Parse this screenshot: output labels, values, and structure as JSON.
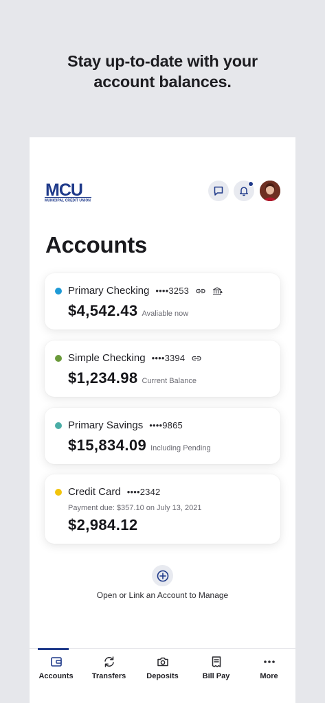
{
  "headline": {
    "line1": "Stay up-to-date with your",
    "line2": "account balances."
  },
  "header": {
    "logo_text": "MCU",
    "logo_subtext": "MUNICIPAL CREDIT UNION",
    "message_icon": "chat-bubble-icon",
    "bell_icon": "bell-icon",
    "avatar_icon": "user-avatar"
  },
  "page_title": "Accounts",
  "accounts": [
    {
      "name": "Primary Checking",
      "mask": "••••3253",
      "amount": "$4,542.43",
      "label": "Avaliable now",
      "color": "#1e9ad6"
    },
    {
      "name": "Simple Checking",
      "mask": "••••3394",
      "amount": "$1,234.98",
      "label": "Current Balance",
      "color": "#6a9a3a"
    },
    {
      "name": "Primary Savings",
      "mask": "••••9865",
      "amount": "$15,834.09",
      "label": "Including Pending",
      "color": "#4aada6"
    },
    {
      "name": "Credit Card",
      "mask": "••••2342",
      "payment_due": "Payment due: $357.10 on July 13, 2021",
      "amount": "$2,984.12",
      "color": "#f2c40c"
    }
  ],
  "add_account": {
    "label": "Open or Link an Account to Manage"
  },
  "tabs": [
    {
      "label": "Accounts",
      "icon": "wallet-icon"
    },
    {
      "label": "Transfers",
      "icon": "transfer-arrows-icon"
    },
    {
      "label": "Deposits",
      "icon": "camera-icon"
    },
    {
      "label": "Bill Pay",
      "icon": "bill-icon"
    },
    {
      "label": "More",
      "icon": "more-dots-icon"
    }
  ],
  "colors": {
    "brand": "#1f3a8a",
    "background": "#e6e7eb"
  }
}
